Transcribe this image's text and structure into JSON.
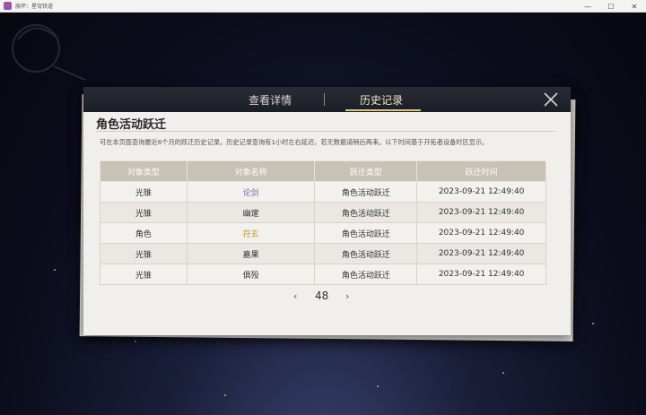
{
  "window": {
    "title": "崩坏：星穹铁道",
    "controls": {
      "minimize": "—",
      "maximize": "☐",
      "close": "✕"
    }
  },
  "panel": {
    "tabs": [
      {
        "label": "查看详情",
        "active": false
      },
      {
        "label": "历史记录",
        "active": true
      }
    ],
    "close_icon": "close-x-icon",
    "section_title": "角色活动跃迁",
    "description": "可在本页面查询最近6个月的跃迁历史记录。历史记录查询有1小时左右延迟，若无数据请稍后再来。以下时间基于开拓者设备时区显示。",
    "table": {
      "headers": [
        "对象类型",
        "对象名称",
        "跃迁类型",
        "跃迁时间"
      ],
      "rows": [
        {
          "type": "光锥",
          "name": "论剑",
          "name_color": "purple",
          "jump": "角色活动跃迁",
          "time": "2023-09-21 12:49:40"
        },
        {
          "type": "光锥",
          "name": "幽邃",
          "name_color": "normal",
          "jump": "角色活动跃迁",
          "time": "2023-09-21 12:49:40"
        },
        {
          "type": "角色",
          "name": "符玄",
          "name_color": "gold",
          "jump": "角色活动跃迁",
          "time": "2023-09-21 12:49:40"
        },
        {
          "type": "光锥",
          "name": "嘉果",
          "name_color": "normal",
          "jump": "角色活动跃迁",
          "time": "2023-09-21 12:49:40"
        },
        {
          "type": "光锥",
          "name": "俱殁",
          "name_color": "normal",
          "jump": "角色活动跃迁",
          "time": "2023-09-21 12:49:40"
        }
      ]
    },
    "pagination": {
      "prev": "‹",
      "page": "48",
      "next": "›"
    }
  },
  "colors": {
    "header_bg": "#1f2129",
    "accent_gold": "#d8c48d",
    "table_header": "#c7c1b6",
    "purple_text": "#8a5cc6",
    "gold_text": "#c79a3a"
  }
}
